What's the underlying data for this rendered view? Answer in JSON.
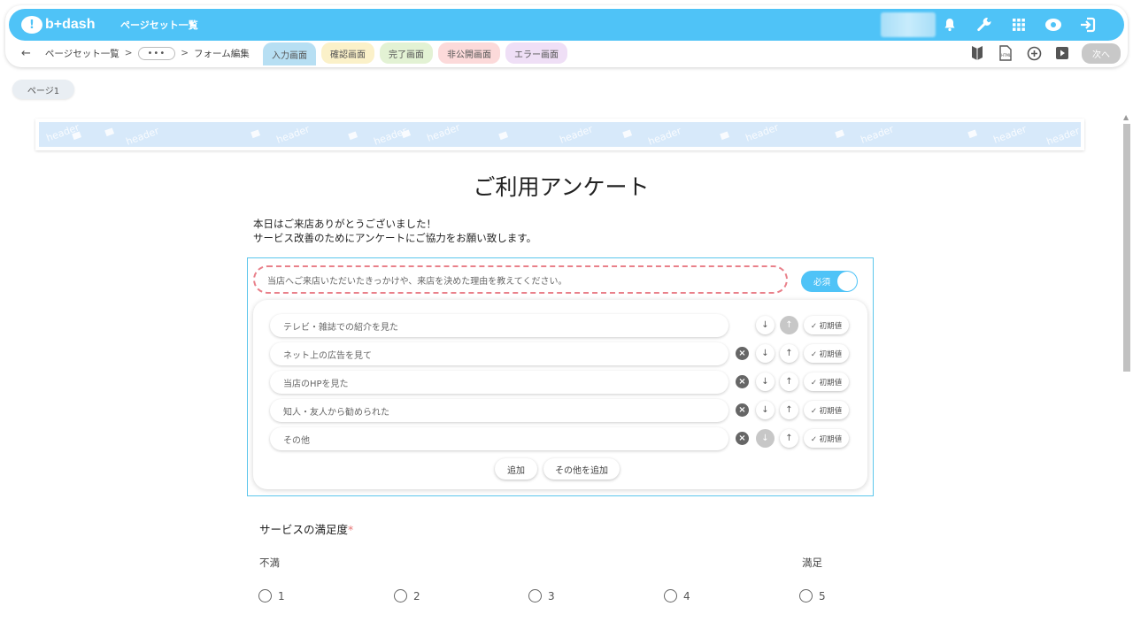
{
  "app": {
    "logo_text": "b+dash",
    "title": "ページセット一覧"
  },
  "breadcrumb": {
    "back": "←",
    "parent": "ページセット一覧",
    "sep": ">",
    "ellipsis": "•••",
    "current": "フォーム編集"
  },
  "tabs": [
    "入力画面",
    "確認画面",
    "完了画面",
    "非公開画面",
    "エラー画面"
  ],
  "toolbar": {
    "next_label": "次へ"
  },
  "page": {
    "pill_label": "ページ1",
    "banner_text": "header"
  },
  "form": {
    "title": "ご利用アンケート",
    "intro_lines": [
      "本日はご来店ありがとうございました！",
      "サービス改善のためにアンケートにご協力をお願い致します。"
    ],
    "question1": {
      "placeholder": "当店へご来店いただいたきっかけや、来店を決めた理由を教えてください。",
      "required_label": "必須",
      "options": [
        "テレビ・雑誌での紹介を見た",
        "ネット上の広告を見て",
        "当店のHPを見た",
        "知人・友人から勧められた",
        "その他"
      ],
      "default_label": "✓ 初期値",
      "add_label": "追加",
      "add_other_label": "その他を追加"
    },
    "question2": {
      "label": "サービスの満足度",
      "required_mark": "*",
      "low_label": "不満",
      "high_label": "満足",
      "choices": [
        "1",
        "2",
        "3",
        "4",
        "5"
      ]
    }
  },
  "colors": {
    "accent": "#4fc3f7",
    "dashed_highlight": "#e9808a"
  }
}
